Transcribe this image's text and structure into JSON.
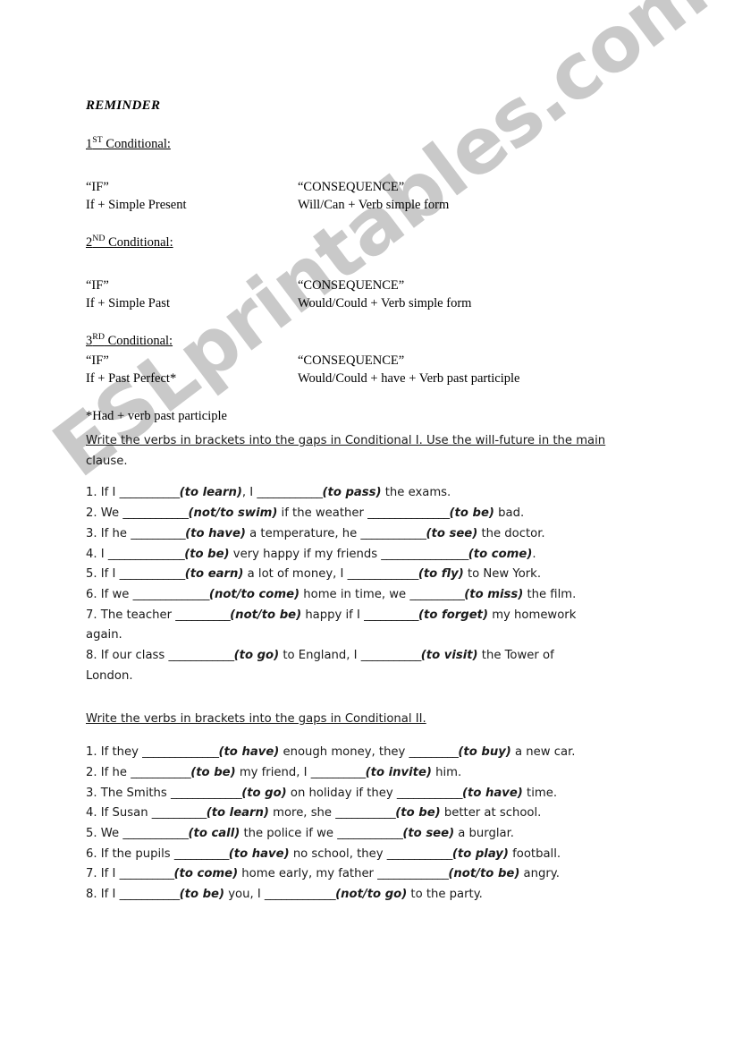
{
  "page": {
    "background_color": "#ffffff",
    "text_color": "#000000"
  },
  "watermark": {
    "text": "ESLprintables.com",
    "color": "#c9c9c9"
  },
  "reminder": {
    "title": "REMINDER",
    "column_headers": {
      "if": "“IF”",
      "consequence": "“CONSEQUENCE”"
    },
    "conditionals": [
      {
        "ordinal": "1",
        "ordinal_suffix": "ST",
        "heading_tail": " Conditional:",
        "if_header": "“IF”",
        "if_formula": "If + Simple Present",
        "consequence_header": "“CONSEQUENCE”",
        "consequence_formula": "Will/Can + Verb simple form"
      },
      {
        "ordinal": "2",
        "ordinal_suffix": "ND",
        "heading_tail": " Conditional:",
        "if_header": "“IF”",
        "if_formula": "If + Simple Past",
        "consequence_header": "“CONSEQUENCE”",
        "consequence_formula": "Would/Could + Verb simple form"
      },
      {
        "ordinal": "3",
        "ordinal_suffix": "RD",
        "heading_tail": " Conditional:",
        "if_header": "“IF”",
        "if_formula": "If + Past Perfect*",
        "consequence_header": "“CONSEQUENCE”",
        "consequence_formula": "Would/Could + have + Verb past participle"
      }
    ],
    "footnote": "*Had + verb past participle"
  },
  "exercise1": {
    "instruction_underlined": "Write the verbs in brackets into the gaps in Conditional I. Use the will-future in the main",
    "instruction_rest": "clause.",
    "items": [
      {
        "number": "1.",
        "p1": " If I ",
        "blank1": "___________",
        "v1": "(to learn)",
        "p2": ", I ",
        "blank2": "____________",
        "v2": "(to pass)",
        "p3": " the exams."
      },
      {
        "number": "2.",
        "p1": " We ",
        "blank1": "____________",
        "v1": "(not/to swim)",
        "p2": " if the weather ",
        "blank2": "_______________",
        "v2": "(to be)",
        "p3": " bad."
      },
      {
        "number": "3.",
        "p1": " If he ",
        "blank1": "__________",
        "v1": "(to have)",
        "p2": " a temperature, he ",
        "blank2": "____________",
        "v2": "(to see)",
        "p3": " the doctor."
      },
      {
        "number": "4.",
        "p1": " I ",
        "blank1": "______________",
        "v1": "(to be)",
        "p2": " very happy if my friends ",
        "blank2": "________________",
        "v2": "(to come)",
        "p3": "."
      },
      {
        "number": "5.",
        "p1": " If I ",
        "blank1": "____________",
        "v1": "(to earn)",
        "p2": " a lot of money, I ",
        "blank2": "_____________",
        "v2": "(to fly)",
        "p3": " to New York."
      },
      {
        "number": "6.",
        "p1": " If we ",
        "blank1": "______________",
        "v1": "(not/to come)",
        "p2": " home in time, we ",
        "blank2": "__________",
        "v2": "(to miss)",
        "p3": " the film."
      },
      {
        "number": "7.",
        "p1": " The teacher ",
        "blank1": "__________",
        "v1": "(not/to be)",
        "p2": " happy if I ",
        "blank2": "__________",
        "v2": "(to forget)",
        "p3": " my homework"
      },
      {
        "number": "8.",
        "p1": " If our class ",
        "blank1": "____________",
        "v1": "(to go)",
        "p2": " to England, I ",
        "blank2": "___________",
        "v2": "(to visit)",
        "p3": " the Tower of"
      }
    ],
    "item7_wrap": "again.",
    "item8_wrap": "London."
  },
  "exercise2": {
    "instruction_underlined": "Write the verbs in brackets into the gaps in Conditional II.",
    "items": [
      {
        "number": "1.",
        "p1": " If they ",
        "blank1": "______________",
        "v1": "(to have)",
        "p2": " enough money, they ",
        "blank2": "_________",
        "v2": "(to buy)",
        "p3": " a new car."
      },
      {
        "number": "2.",
        "p1": " If he ",
        "blank1": "___________",
        "v1": "(to be)",
        "p2": " my friend, I ",
        "blank2": "__________",
        "v2": "(to invite)",
        "p3": " him."
      },
      {
        "number": "3.",
        "p1": " The Smiths ",
        "blank1": "_____________",
        "v1": "(to go)",
        "p2": " on holiday if they ",
        "blank2": "____________",
        "v2": "(to have)",
        "p3": " time."
      },
      {
        "number": "4.",
        "p1": " If Susan ",
        "blank1": "__________",
        "v1": "(to learn)",
        "p2": " more, she ",
        "blank2": "___________",
        "v2": "(to be)",
        "p3": " better at school."
      },
      {
        "number": "5.",
        "p1": " We ",
        "blank1": "____________",
        "v1": "(to call)",
        "p2": " the police if we ",
        "blank2": "____________",
        "v2": "(to see)",
        "p3": " a burglar."
      },
      {
        "number": "6.",
        "p1": " If the pupils ",
        "blank1": "__________",
        "v1": "(to have)",
        "p2": " no school, they ",
        "blank2": "____________",
        "v2": "(to play)",
        "p3": " football."
      },
      {
        "number": "7.",
        "p1": " If I ",
        "blank1": "__________",
        "v1": "(to come)",
        "p2": " home early, my father ",
        "blank2": "_____________",
        "v2": "(not/to be)",
        "p3": " angry."
      },
      {
        "number": "8.",
        "p1": " If I ",
        "blank1": "___________",
        "v1": "(to be)",
        "p2": " you, I ",
        "blank2": "_____________",
        "v2": "(not/to go)",
        "p3": " to the party."
      }
    ]
  }
}
